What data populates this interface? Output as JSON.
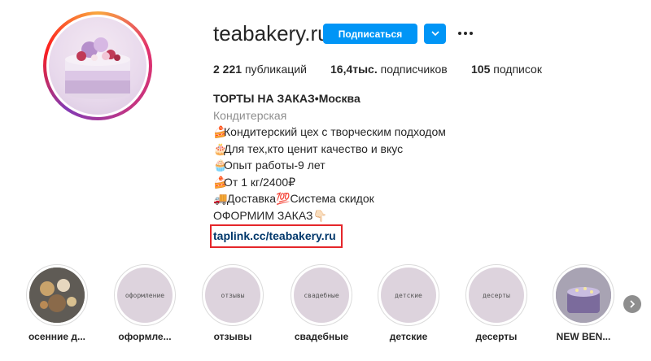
{
  "profile": {
    "username": "teabakery.ru",
    "follow_label": "Подписаться",
    "posts_count": "2 221",
    "posts_label": "публикаций",
    "followers_count": "16,4тыс.",
    "followers_label": "подписчиков",
    "following_count": "105",
    "following_label": "подписок"
  },
  "bio": {
    "name": "ТОРТЫ НА ЗАКАЗ•Москва",
    "category": "Кондитерская",
    "lines": [
      {
        "emoji": "🍰",
        "text": "Кондитерский цех с творческим подходом"
      },
      {
        "emoji": "🎂",
        "text": "Для тех,кто ценит качество и вкус"
      },
      {
        "emoji": "🧁",
        "text": "Опыт работы-9 лет"
      },
      {
        "emoji": "🍰",
        "text": "От 1 кг/2400₽"
      },
      {
        "emoji": "🚚",
        "text": " Доставка💯Система скидок"
      },
      {
        "emoji": "",
        "text": "ОФОРМИМ ЗАКАЗ👇🏻"
      }
    ],
    "link": "taplink.cc/teabakery.ru"
  },
  "highlights": [
    {
      "label": "осенние д...",
      "cover_text": ""
    },
    {
      "label": "оформле...",
      "cover_text": "оформление"
    },
    {
      "label": "отзывы",
      "cover_text": "отзывы"
    },
    {
      "label": "свадебные",
      "cover_text": "свадебные"
    },
    {
      "label": "детские",
      "cover_text": "детские"
    },
    {
      "label": "десерты",
      "cover_text": "десерты"
    },
    {
      "label": "NEW BEN...",
      "cover_text": ""
    }
  ],
  "colors": {
    "follow_button": "#0095f6",
    "link": "#00376b",
    "link_box_border": "#e5262a",
    "highlight_cover": "#ddd3dd"
  },
  "icons": [
    "chevron-down-icon",
    "more-options-icon",
    "chevron-right-icon"
  ]
}
